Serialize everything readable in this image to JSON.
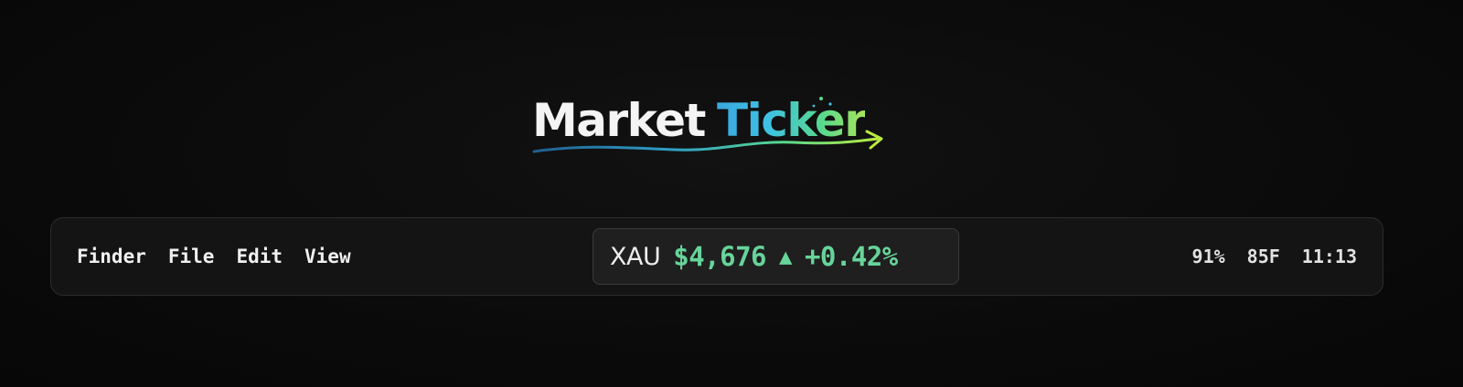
{
  "logo": {
    "word1": "Market",
    "word2": "Ticker",
    "swoosh_icon": "trend-swoosh-arrow",
    "gradient_colors": [
      "#2f7fb6",
      "#3fc1e3",
      "#56d88f",
      "#b8ea3e"
    ]
  },
  "menubar": {
    "items": [
      {
        "label": "Finder"
      },
      {
        "label": "File"
      },
      {
        "label": "Edit"
      },
      {
        "label": "View"
      }
    ],
    "ticker": {
      "symbol": "XAU",
      "price": "$4,676",
      "direction_icon": "up-triangle-icon",
      "arrow": "▲",
      "change": "+0.42%",
      "accent_color": "#67d49a"
    },
    "status": {
      "battery": "91%",
      "weather": "85F",
      "clock": "11:13"
    }
  },
  "colors": {
    "background": "#0a0a0a",
    "bar_background": "#141414",
    "ticker_background": "#1f1f1f",
    "positive": "#67d49a"
  }
}
